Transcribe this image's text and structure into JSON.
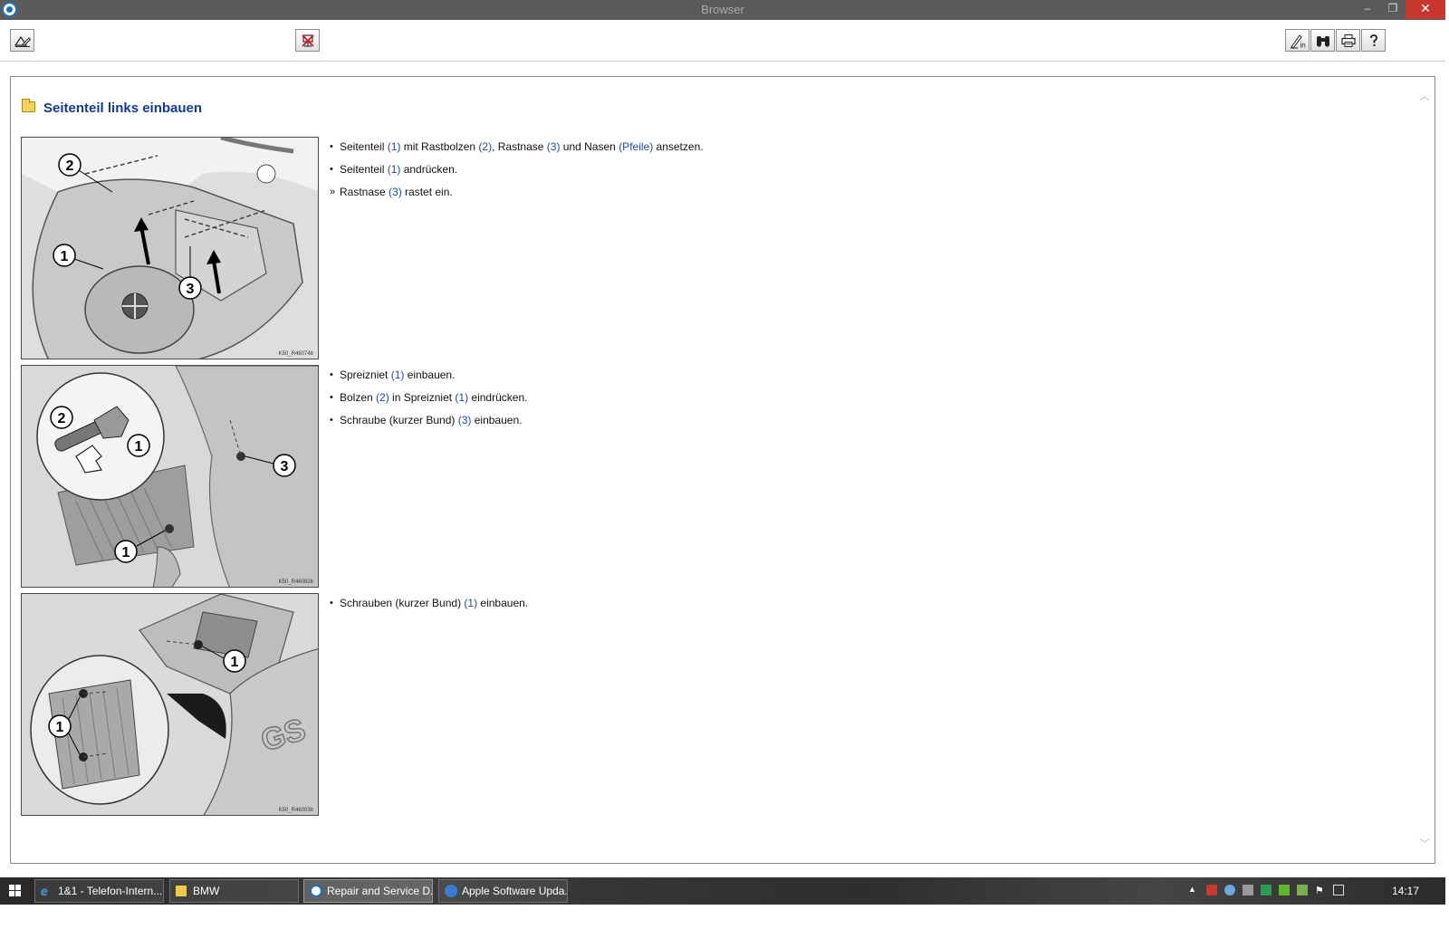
{
  "window": {
    "title": "Browser",
    "minimize_label": "–",
    "maximize_label": "❐",
    "close_label": "✕"
  },
  "toolbar": {
    "left_buttons": [
      {
        "icon": "edit-note-icon"
      },
      {
        "icon": "disconnect-icon"
      }
    ],
    "right_buttons": [
      {
        "icon": "info-icon"
      },
      {
        "icon": "search-binoculars-icon"
      },
      {
        "icon": "print-icon"
      },
      {
        "icon": "help-icon"
      }
    ]
  },
  "page": {
    "heading": "Seitenteil links einbauen",
    "heading_icon": "folder-icon"
  },
  "sections": [
    {
      "figure_code": "K50_R46074b",
      "callouts": [
        "1",
        "2",
        "3"
      ],
      "steps": [
        {
          "marker": "•",
          "segments": [
            {
              "t": "Seitenteil "
            },
            {
              "t": "(1)",
              "ref": true
            },
            {
              "t": " mit Rastbolzen "
            },
            {
              "t": "(2)",
              "ref": true
            },
            {
              "t": ", Rastnase "
            },
            {
              "t": "(3)",
              "ref": true
            },
            {
              "t": " und Nasen "
            },
            {
              "t": "(Pfeile)",
              "ref": true
            },
            {
              "t": " ansetzen."
            }
          ]
        },
        {
          "marker": "•",
          "segments": [
            {
              "t": "Seitenteil "
            },
            {
              "t": "(1)",
              "ref": true
            },
            {
              "t": " andrücken."
            }
          ]
        },
        {
          "marker": "»",
          "segments": [
            {
              "t": "Rastnase "
            },
            {
              "t": "(3)",
              "ref": true
            },
            {
              "t": " rastet ein."
            }
          ]
        }
      ]
    },
    {
      "figure_code": "K50_R46082b",
      "callouts": [
        "1",
        "2",
        "3"
      ],
      "steps": [
        {
          "marker": "•",
          "segments": [
            {
              "t": "Spreizniet "
            },
            {
              "t": "(1)",
              "ref": true
            },
            {
              "t": " einbauen."
            }
          ]
        },
        {
          "marker": "•",
          "segments": [
            {
              "t": "Bolzen "
            },
            {
              "t": "(2)",
              "ref": true
            },
            {
              "t": " in Spreizniet "
            },
            {
              "t": "(1)",
              "ref": true
            },
            {
              "t": " eindrücken."
            }
          ]
        },
        {
          "marker": "•",
          "segments": [
            {
              "t": "Schraube (kurzer Bund) "
            },
            {
              "t": "(3)",
              "ref": true
            },
            {
              "t": " einbauen."
            }
          ]
        }
      ]
    },
    {
      "figure_code": "K50_R46003b",
      "callouts": [
        "1"
      ],
      "steps": [
        {
          "marker": "•",
          "segments": [
            {
              "t": "Schrauben (kurzer Bund) "
            },
            {
              "t": "(1)",
              "ref": true
            },
            {
              "t": " einbauen."
            }
          ]
        }
      ]
    }
  ],
  "scrollbar": {
    "up_icon": "chevron-up-icon",
    "down_icon": "chevron-down-icon"
  },
  "taskbar": {
    "items": [
      {
        "label": "1&1 - Telefon-Intern...",
        "icon": "ie-icon",
        "active": false
      },
      {
        "label": "BMW",
        "icon": "folder-icon",
        "active": false
      },
      {
        "label": "Repair and Service D...",
        "icon": "bmw-app-icon",
        "active": true
      },
      {
        "label": "Apple Software Upda...",
        "icon": "apple-update-icon",
        "active": false
      }
    ],
    "clock": "14:17"
  },
  "colors": {
    "accent": "#13389a",
    "ref": "#1c4aa8",
    "close": "#c7372f"
  }
}
